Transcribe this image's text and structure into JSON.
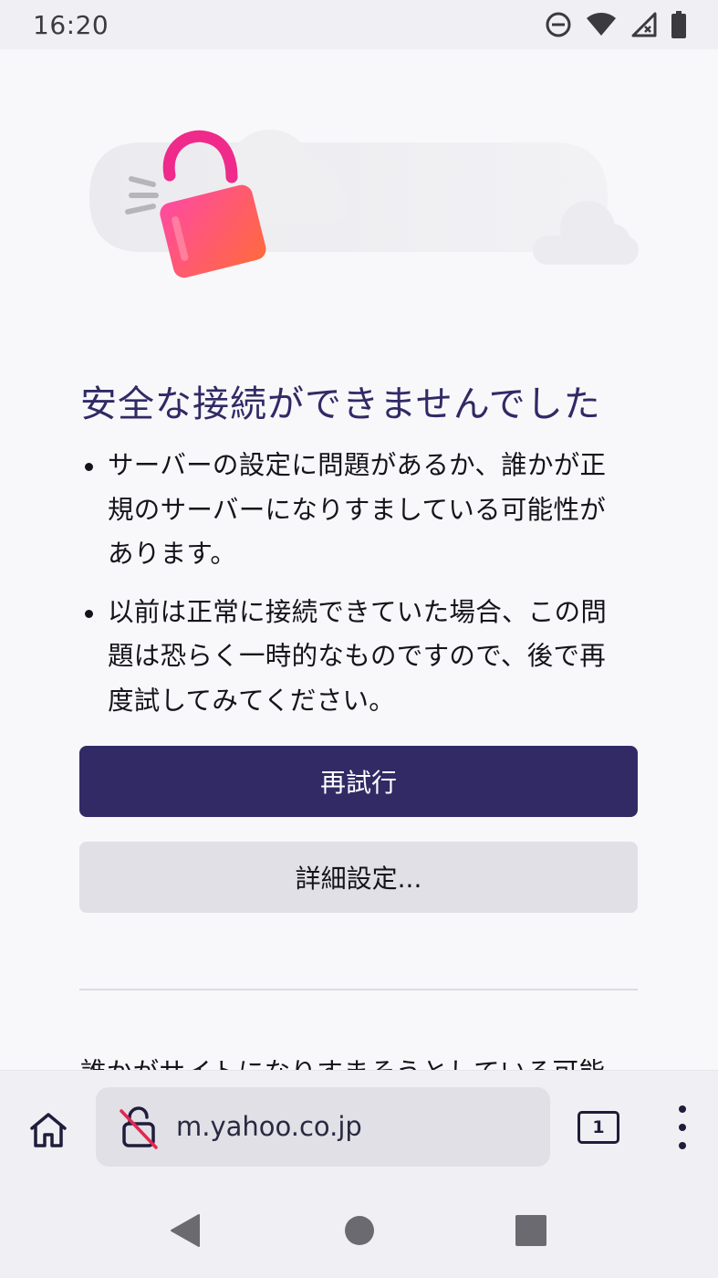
{
  "status_bar": {
    "time": "16:20",
    "icons": [
      "do-not-disturb-icon",
      "wifi-icon",
      "signal-no-service-icon",
      "battery-icon"
    ]
  },
  "error_page": {
    "title": "安全な接続ができませんでした",
    "bullets": [
      "サーバーの設定に問題があるか、誰かが正規のサーバーになりすましている可能性があります。",
      "以前は正常に接続できていた場合、この問題は恐らく一時的なものですので、後で再度試してみてください。"
    ],
    "retry_label": "再試行",
    "advanced_label": "詳細設定...",
    "more_text_partial": "誰かがサイトになりすまそうとしている可能"
  },
  "toolbar": {
    "url": "m.yahoo.co.jp",
    "tab_count": "1",
    "icons": [
      "home-icon",
      "insecure-lock-icon",
      "tabs-icon",
      "overflow-menu-icon"
    ]
  },
  "colors": {
    "accent": "#312a65",
    "background": "#f8f8fb",
    "secondary_button": "#e0e0e6",
    "lock_gradient_start": "#ff4aa2",
    "lock_gradient_end": "#ff6a3d"
  }
}
